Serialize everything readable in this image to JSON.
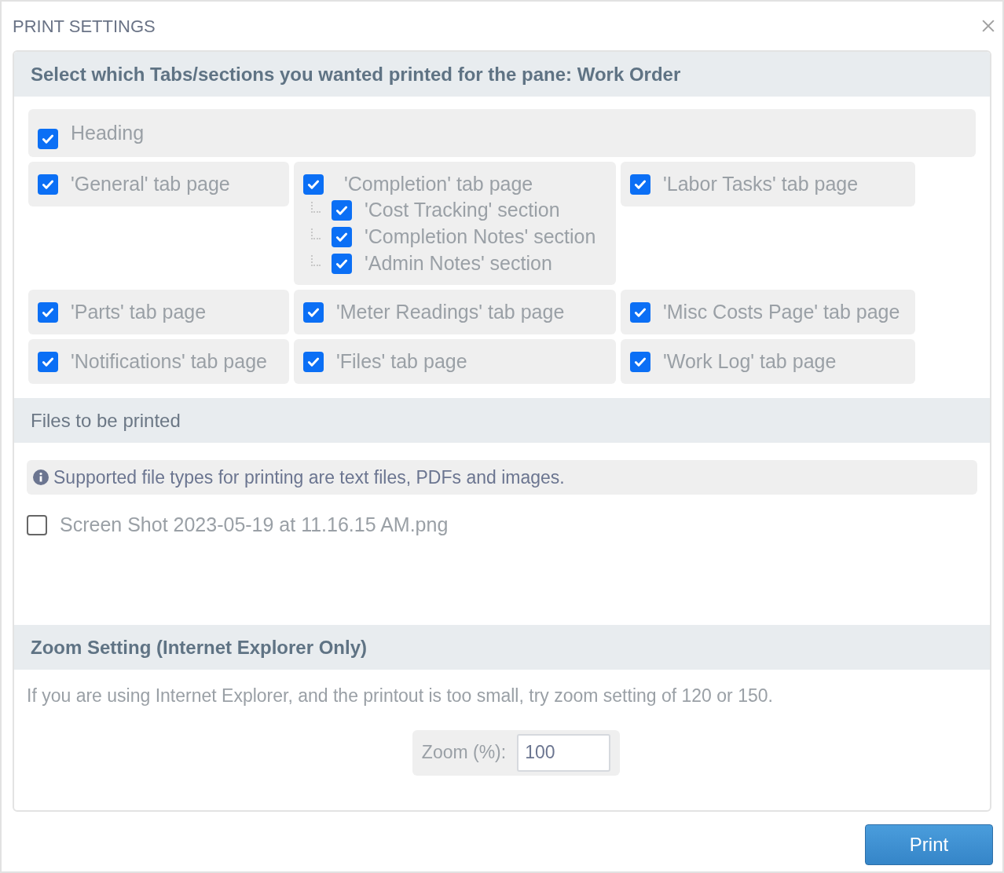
{
  "dialog": {
    "title": "PRINT SETTINGS"
  },
  "tabs_section": {
    "heading": "Select which Tabs/sections you wanted printed for the pane: Work Order",
    "bold": true,
    "heading_item": {
      "label": "Heading",
      "checked": true
    },
    "items": [
      {
        "label": "'General' tab page",
        "checked": true
      },
      {
        "label": "'Completion' tab page",
        "checked": true,
        "children": [
          {
            "label": "'Cost Tracking' section",
            "checked": true
          },
          {
            "label": "'Completion Notes' section",
            "checked": true
          },
          {
            "label": "'Admin Notes' section",
            "checked": true
          }
        ]
      },
      {
        "label": "'Labor Tasks' tab page",
        "checked": true
      },
      {
        "label": "'Parts' tab page",
        "checked": true
      },
      {
        "label": "'Meter Readings' tab page",
        "checked": true
      },
      {
        "label": "'Misc Costs Page' tab page",
        "checked": true
      },
      {
        "label": "'Notifications' tab page",
        "checked": true
      },
      {
        "label": "'Files' tab page",
        "checked": true
      },
      {
        "label": "'Work Log' tab page",
        "checked": true
      }
    ]
  },
  "files_section": {
    "heading": "Files to be printed",
    "bold": false,
    "info": "Supported file types for printing are text files, PDFs and images.",
    "files": [
      {
        "name": "Screen Shot 2023-05-19 at 11.16.15 AM.png",
        "checked": false
      }
    ]
  },
  "zoom_section": {
    "heading": "Zoom Setting (Internet Explorer Only)",
    "bold": true,
    "description": "If you are using Internet Explorer, and the printout is too small, try zoom setting of 120 or 150.",
    "field_label": "Zoom (%):",
    "value": "100"
  },
  "print_button": "Print"
}
